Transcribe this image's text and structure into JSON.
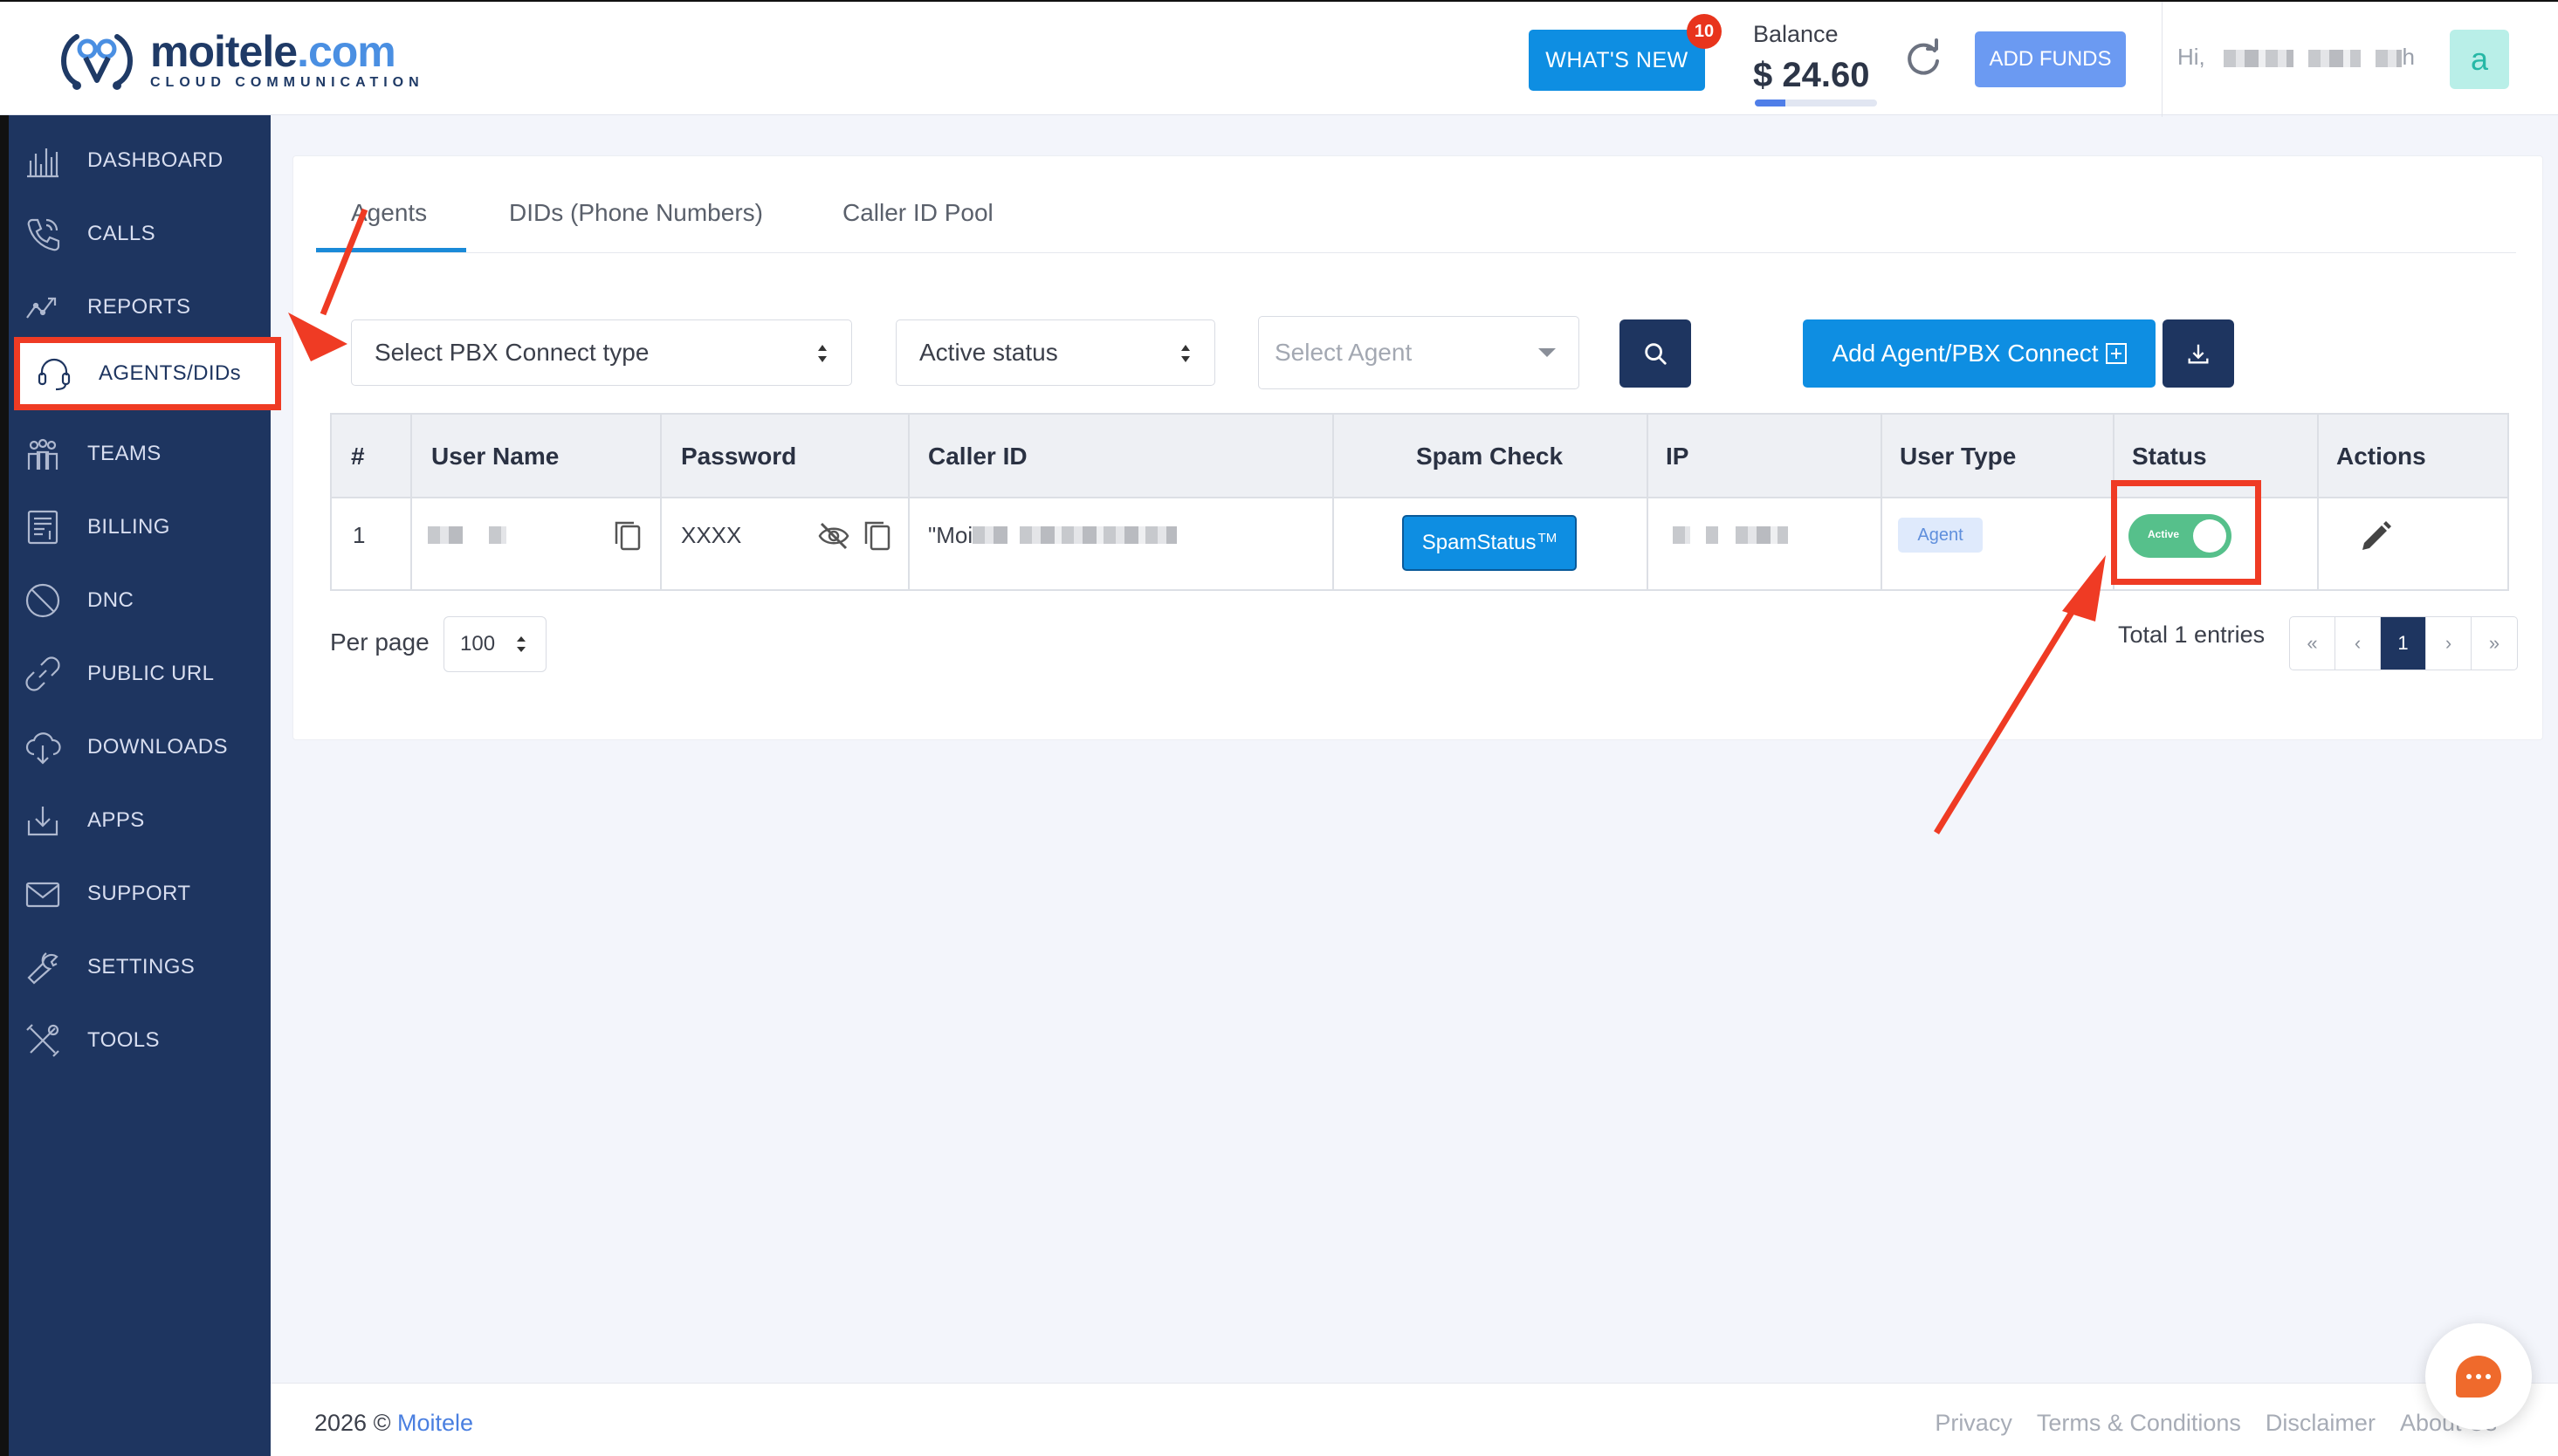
{
  "header": {
    "brand_main": "moitele",
    "brand_tld": ".com",
    "brand_tag": "CLOUD COMMUNICATION",
    "whats_new_label": "WHAT'S NEW",
    "whats_new_count": "10",
    "balance_label": "Balance",
    "balance_value": "$ 24.60",
    "balance_progress": 0.25,
    "add_funds_label": "ADD FUNDS",
    "greeting": "Hi,",
    "user_suffix": "h",
    "avatar_letter": "a"
  },
  "sidebar": {
    "items": [
      {
        "label": "DASHBOARD",
        "icon": "dashboard-icon"
      },
      {
        "label": "CALLS",
        "icon": "phone-icon"
      },
      {
        "label": "REPORTS",
        "icon": "trend-icon"
      },
      {
        "label": "AGENTS/DIDs",
        "icon": "headset-icon",
        "active": true
      },
      {
        "label": "TEAMS",
        "icon": "team-icon"
      },
      {
        "label": "BILLING",
        "icon": "billing-icon"
      },
      {
        "label": "DNC",
        "icon": "block-icon"
      },
      {
        "label": "PUBLIC URL",
        "icon": "link-icon"
      },
      {
        "label": "DOWNLOADS",
        "icon": "cloud-download-icon"
      },
      {
        "label": "APPS",
        "icon": "apps-download-icon"
      },
      {
        "label": "SUPPORT",
        "icon": "mail-icon"
      },
      {
        "label": "SETTINGS",
        "icon": "wrench-icon"
      },
      {
        "label": "TOOLS",
        "icon": "tools-icon"
      }
    ]
  },
  "tabs": [
    {
      "label": "Agents",
      "active": true
    },
    {
      "label": "DIDs (Phone Numbers)"
    },
    {
      "label": "Caller ID Pool"
    }
  ],
  "filters": {
    "pbx_type": "Select PBX Connect type",
    "status": "Active status",
    "agent_placeholder": "Select Agent",
    "add_button": "Add Agent/PBX Connect"
  },
  "table": {
    "headers": [
      "#",
      "User Name",
      "Password",
      "Caller ID",
      "Spam Check",
      "IP",
      "User Type",
      "Status",
      "Actions"
    ],
    "rows": [
      {
        "num": "1",
        "password": "XXXX",
        "caller_id_prefix": "\"Moi",
        "spam_label": "SpamStatus",
        "spam_tm": "TM",
        "user_type": "Agent",
        "status": "Active"
      }
    ]
  },
  "pagination": {
    "per_page_label": "Per page",
    "per_page_value": "100",
    "total": "Total 1 entries",
    "first": "«",
    "prev": "‹",
    "current": "1",
    "next": "›",
    "last": "»"
  },
  "footer": {
    "copyright": "2026 ©",
    "company": "Moitele",
    "links": [
      "Privacy",
      "Terms & Conditions",
      "Disclaimer",
      "About Us"
    ]
  },
  "colors": {
    "sidebar": "#1e3560",
    "accent": "#0e8ee2",
    "annotation": "#ef3b24",
    "toggle_on": "#56c08b"
  }
}
